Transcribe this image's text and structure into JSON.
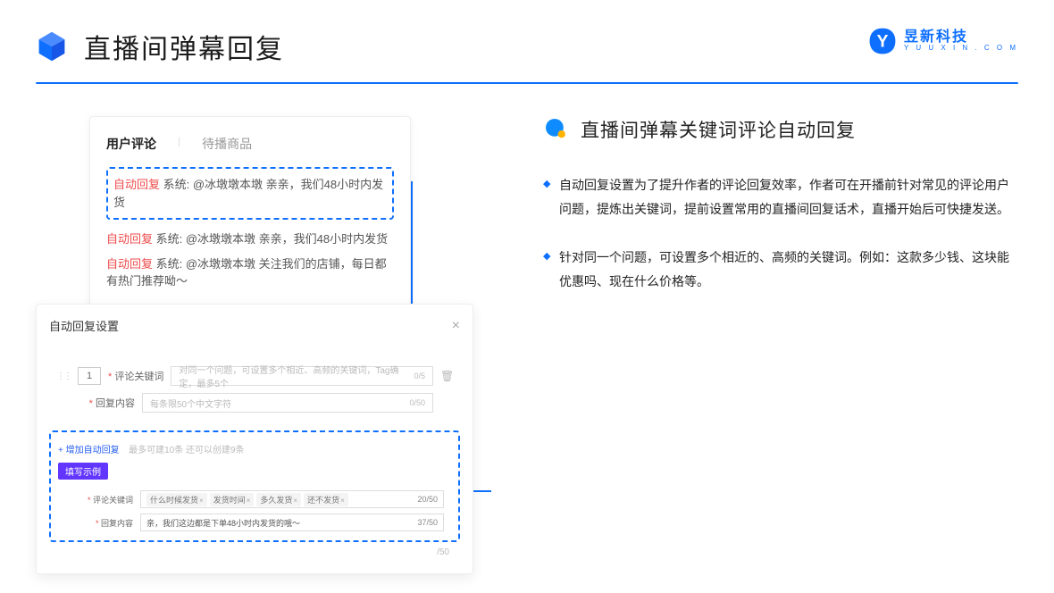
{
  "header": {
    "title": "直播间弹幕回复"
  },
  "brand": {
    "cn": "昱新科技",
    "en": "Y U U X I N . C O M"
  },
  "tabs": {
    "active": "用户评论",
    "inactive": "待播商品"
  },
  "comments": {
    "hl_prefix": "自动回复",
    "hl_text": "系统: @冰墩墩本墩 亲亲，我们48小时内发货",
    "line2_prefix": "自动回复",
    "line2_text": "系统: @冰墩墩本墩 亲亲，我们48小时内发货",
    "line3_prefix": "自动回复",
    "line3_text": "系统: @冰墩墩本墩 关注我们的店铺，每日都有热门推荐呦～"
  },
  "settings": {
    "title": "自动回复设置",
    "idx": "1",
    "kw_label": "评论关键词",
    "kw_placeholder": "对同一个问题，可设置多个相近、高频的关键词，Tag确定，最多5个",
    "kw_count": "0/5",
    "cnt_label": "回复内容",
    "cnt_placeholder": "每条限50个中文字符",
    "cnt_count": "0/50",
    "add_label": "+ 增加自动回复",
    "add_note": "最多可建10条 还可以创建9条",
    "example_btn": "填写示例",
    "ex_kw_label": "评论关键词",
    "ex_tags": [
      "什么时候发货",
      "发货时间",
      "多久发货",
      "还不发货"
    ],
    "ex_kw_count": "20/50",
    "ex_cnt_label": "回复内容",
    "ex_cnt_val": "亲，我们这边都是下单48小时内发货的哦～",
    "ex_cnt_count": "37/50",
    "footer_cnt": "/50"
  },
  "right": {
    "title": "直播间弹幕关键词评论自动回复",
    "b1": "自动回复设置为了提升作者的评论回复效率，作者可在开播前针对常见的评论用户问题，提炼出关键词，提前设置常用的直播间回复话术，直播开始后可快捷发送。",
    "b2": "针对同一个问题，可设置多个相近的、高频的关键词。例如：这款多少钱、这块能优惠吗、现在什么价格等。"
  }
}
